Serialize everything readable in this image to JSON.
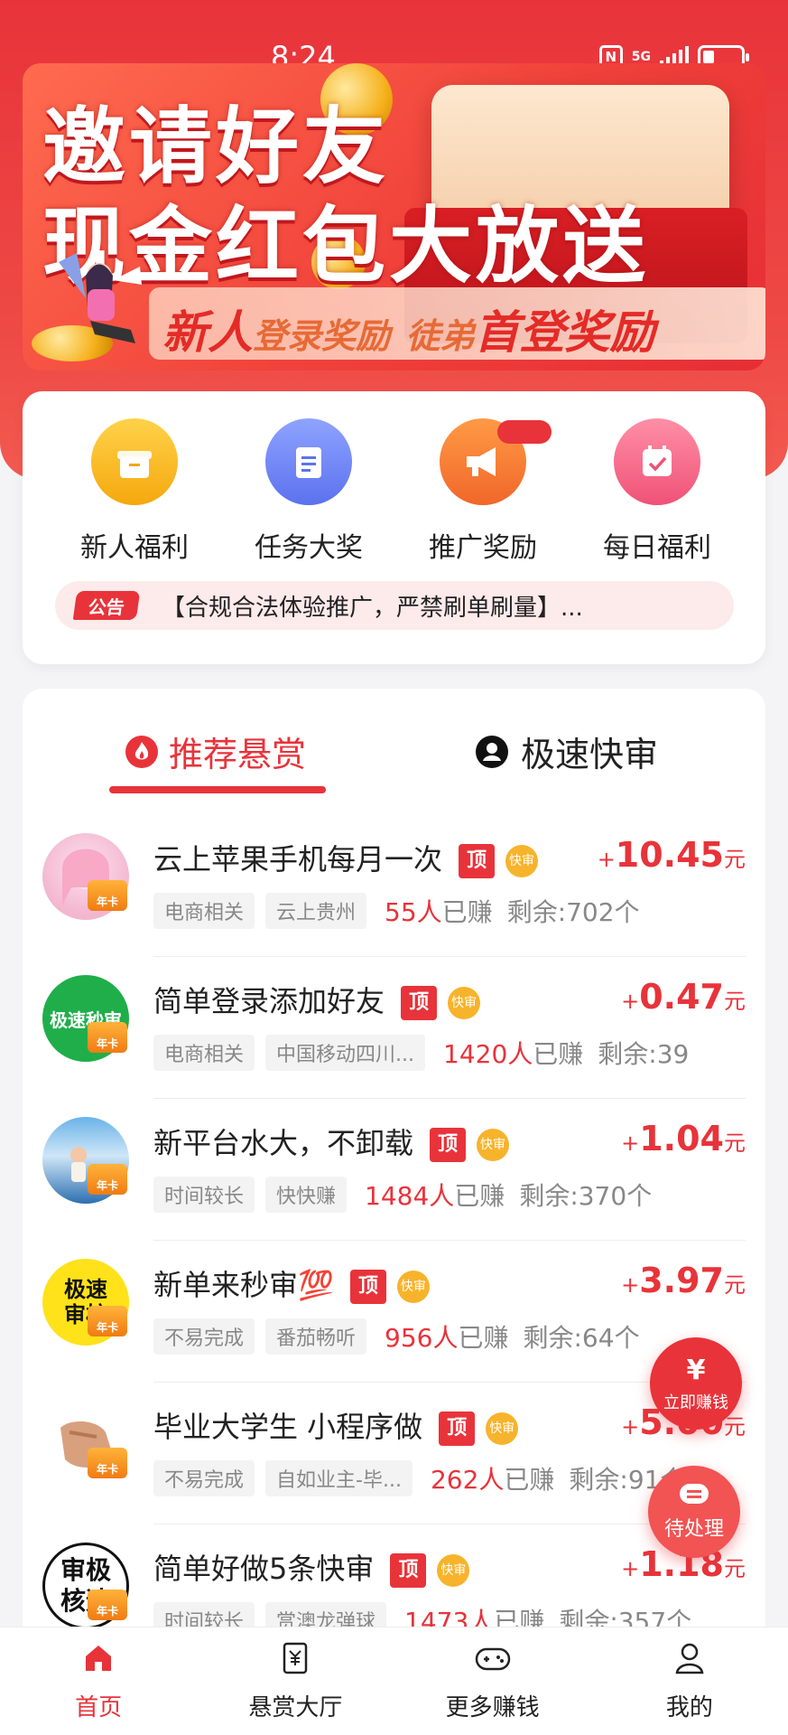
{
  "status_bar": {
    "time": "8:24",
    "network": "5G"
  },
  "banner": {
    "title_line1": "邀请好友",
    "title_line2": "现金红包大放送",
    "sub_part1": "新人",
    "sub_part2": "登录奖励",
    "sub_part3": "徒弟",
    "sub_part4": "首登奖励"
  },
  "quick_menu": {
    "items": [
      {
        "label": "新人福利",
        "icon": "gift-box-icon",
        "color": "#f7b71d"
      },
      {
        "label": "任务大奖",
        "icon": "clipboard-icon",
        "color": "#6d84f5"
      },
      {
        "label": "推广奖励",
        "icon": "megaphone-icon",
        "color": "#f57b30"
      },
      {
        "label": "每日福利",
        "icon": "calendar-check-icon",
        "color": "#f2607b"
      }
    ],
    "notice_tag": "公告",
    "notice_text": "【合规合法体验推广，严禁刷单刷量】..."
  },
  "tabs": {
    "recommended": "推荐悬赏",
    "fast_review": "极速快审"
  },
  "tasks": [
    {
      "title": "云上苹果手机每月一次",
      "top": "顶",
      "fast": "快审",
      "plus": "+",
      "amount": "10.45",
      "unit": "元",
      "tag1": "电商相关",
      "tag2": "云上贵州",
      "earned_count": "55人",
      "earned_suffix": "已赚",
      "remaining": "剩余:702个",
      "crown": "年卡"
    },
    {
      "title": "简单登录添加好友",
      "top": "顶",
      "fast": "快审",
      "plus": "+",
      "amount": "0.47",
      "unit": "元",
      "tag1": "电商相关",
      "tag2": "中国移动四川...",
      "earned_count": "1420人",
      "earned_suffix": "已赚",
      "remaining": "剩余:39",
      "crown": "年卡",
      "avatar_text": "极速秒审"
    },
    {
      "title": "新平台水大，不卸载",
      "top": "顶",
      "fast": "快审",
      "plus": "+",
      "amount": "1.04",
      "unit": "元",
      "tag1": "时间较长",
      "tag2": "快快赚",
      "earned_count": "1484人",
      "earned_suffix": "已赚",
      "remaining": "剩余:370个",
      "crown": "年卡"
    },
    {
      "title": "新单来秒审💯",
      "top": "顶",
      "fast": "快审",
      "plus": "+",
      "amount": "3.97",
      "unit": "元",
      "tag1": "不易完成",
      "tag2": "番茄畅听",
      "earned_count": "956人",
      "earned_suffix": "已赚",
      "remaining": "剩余:64个",
      "crown": "年卡",
      "avatar_text": "极速审核"
    },
    {
      "title": "毕业大学生 小程序做",
      "top": "顶",
      "fast": "快审",
      "plus": "+",
      "amount": "5.00",
      "unit": "元",
      "tag1": "不易完成",
      "tag2": "自如业主-毕...",
      "earned_count": "262人",
      "earned_suffix": "已赚",
      "remaining": "剩余:91个",
      "crown": "年卡"
    },
    {
      "title": "简单好做5条快审",
      "top": "顶",
      "fast": "快审",
      "plus": "+",
      "amount": "1.18",
      "unit": "元",
      "tag1": "时间较长",
      "tag2": "赏澳龙弹球",
      "earned_count": "1473人",
      "earned_suffix": "已赚",
      "remaining": "剩余:357个",
      "crown": "年卡",
      "avatar_text": "审极核速"
    }
  ],
  "floating": {
    "earn_label": "立即赚钱",
    "pending_label": "待处理",
    "earn_symbol": "¥"
  },
  "bottom_nav": [
    {
      "label": "首页",
      "icon": "home-icon",
      "active": true
    },
    {
      "label": "悬赏大厅",
      "icon": "reward-hall-icon",
      "active": false
    },
    {
      "label": "更多赚钱",
      "icon": "gamepad-icon",
      "active": false
    },
    {
      "label": "我的",
      "icon": "user-icon",
      "active": false
    }
  ]
}
